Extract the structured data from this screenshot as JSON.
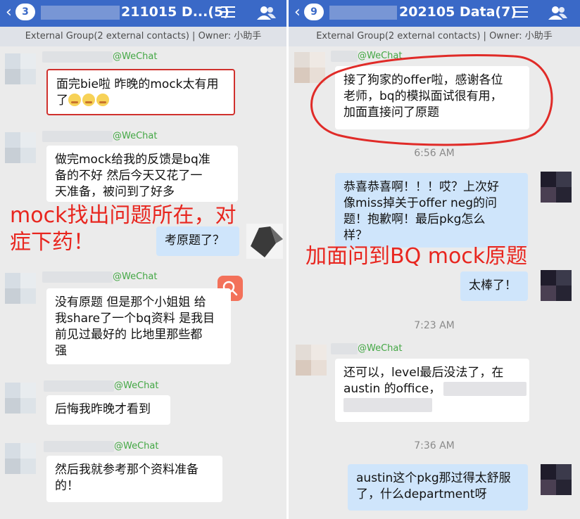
{
  "left_chat": {
    "back_icon": "chevron-left-icon",
    "badge": "3",
    "title": "211015 D...(5)",
    "subtitle": "External Group(2 external contacts) | Owner: 小助手",
    "wechat_tag": "@WeChat",
    "messages": [
      {
        "text_lines": [
          "面完bie啦 昨晚的mock太有用",
          "了"
        ]
      },
      {
        "text_lines": [
          "做完mock给我的反馈是bq准",
          "备的不好 然后今天又花了一",
          "天准备，被问到了好多"
        ]
      },
      {
        "text_lines": [
          "考原题了？"
        ]
      },
      {
        "text_lines": [
          "没有原题 但是那个小姐姐 给",
          "我share了一个bq资料 是我目",
          "前见过最好的 比地里那些都",
          "强"
        ]
      },
      {
        "text_lines": [
          "后悔我昨晚才看到"
        ]
      },
      {
        "text_lines": [
          "然后我就参考那个资料准备",
          "的！"
        ]
      }
    ],
    "annotation_lines": [
      "mock找出问题所在，对",
      "症下药！"
    ],
    "search_icon": "search-icon"
  },
  "right_chat": {
    "back_icon": "chevron-left-icon",
    "badge": "9",
    "title": "202105 Data(7)",
    "subtitle": "External Group(2 external contacts) | Owner: 小助手",
    "wechat_tag": "@WeChat",
    "messages": [
      {
        "text_lines": [
          "接了狗家的offer啦，感谢各位",
          "老师，bq的模拟面试很有用，",
          "加面直接问了原题"
        ]
      },
      {
        "text_lines": [
          "恭喜恭喜啊！！！哎？上次好",
          "像miss掉关于offer neg的问",
          "题！抱歉啊！最后pkg怎么",
          "样？"
        ]
      },
      {
        "text_lines": [
          "太棒了！"
        ]
      },
      {
        "text_lines": [
          "还可以，level最后没法了，在",
          "austin 的office，"
        ]
      },
      {
        "text_lines": [
          "austin这个pkg那过得太舒服",
          "了，什么department呀"
        ]
      }
    ],
    "times": [
      "6:56 AM",
      "7:23 AM",
      "7:36 AM"
    ],
    "annotation": "加面问到BQ mock原题"
  },
  "colors": {
    "navbar": "#3a69c7",
    "annotation": "#e8261f",
    "wechat_tag": "#43a744",
    "my_bubble": "#cfe5fb"
  }
}
